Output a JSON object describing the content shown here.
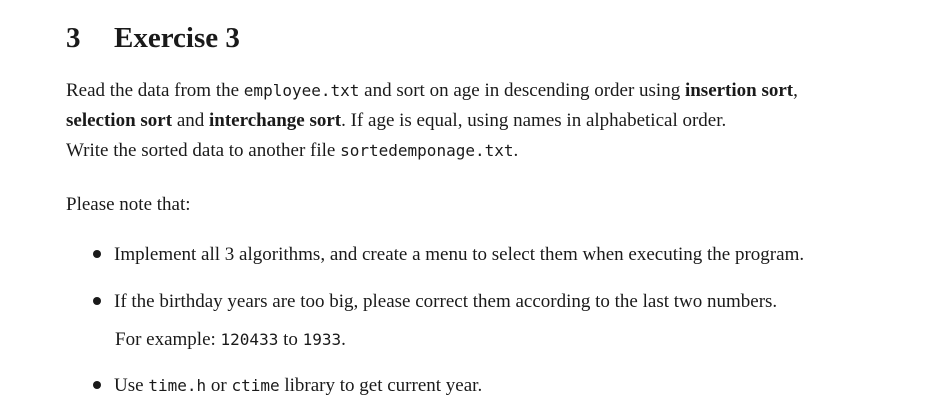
{
  "section": {
    "number": "3",
    "title": "Exercise 3"
  },
  "intro": {
    "line1": {
      "t1": "Read the data from the ",
      "file1": "employee.txt",
      "t2": " and sort on age in descending order using ",
      "b1": "insertion sort",
      "t3": ","
    },
    "line2": {
      "b2": "selection sort",
      "t4": " and ",
      "b3": "interchange sort",
      "t5": ". If age is equal, using names in alphabetical order."
    },
    "line3": {
      "t6": "Write the sorted data to another file ",
      "file2": "sortedemponage.txt",
      "t7": "."
    }
  },
  "note_label": "Please note that:",
  "bullets": {
    "b1": "Implement all 3 algorithms, and create a menu to select them when executing the program.",
    "b2": "If the birthday years are too big, please correct them according to the last two numbers.",
    "example": {
      "t1": "For example: ",
      "from": "120433",
      "t2": " to ",
      "to": "1933",
      "t3": "."
    },
    "b3": {
      "t1": "Use ",
      "lib1": "time.h",
      "t2": " or ",
      "lib2": "ctime",
      "t3": " library to get current year."
    }
  }
}
